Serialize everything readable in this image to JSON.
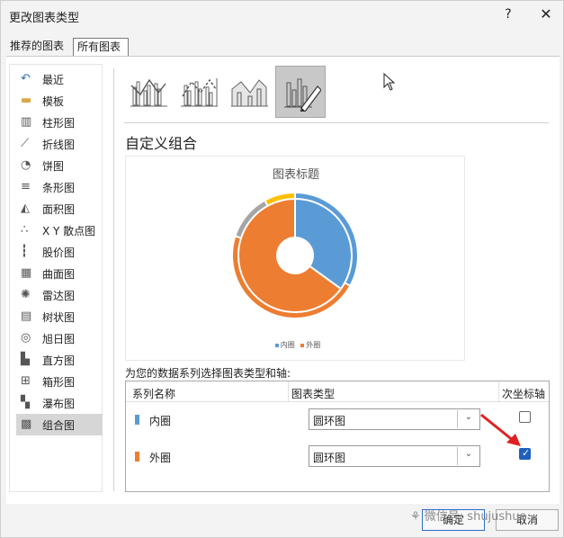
{
  "window": {
    "title": "更改图表类型",
    "help": "?",
    "close": "✕"
  },
  "tabs": [
    {
      "label": "推荐的图表",
      "active": false
    },
    {
      "label": "所有图表",
      "active": true
    }
  ],
  "sidebar": {
    "items": [
      {
        "label": "最近",
        "icon": "recent-icon"
      },
      {
        "label": "模板",
        "icon": "folder-icon"
      },
      {
        "label": "柱形图",
        "icon": "column-chart-icon"
      },
      {
        "label": "折线图",
        "icon": "line-chart-icon"
      },
      {
        "label": "饼图",
        "icon": "pie-chart-icon"
      },
      {
        "label": "条形图",
        "icon": "bar-chart-icon"
      },
      {
        "label": "面积图",
        "icon": "area-chart-icon"
      },
      {
        "label": "X Y 散点图",
        "icon": "scatter-chart-icon"
      },
      {
        "label": "股价图",
        "icon": "stock-chart-icon"
      },
      {
        "label": "曲面图",
        "icon": "surface-chart-icon"
      },
      {
        "label": "雷达图",
        "icon": "radar-chart-icon"
      },
      {
        "label": "树状图",
        "icon": "treemap-chart-icon"
      },
      {
        "label": "旭日图",
        "icon": "sunburst-chart-icon"
      },
      {
        "label": "直方图",
        "icon": "histogram-chart-icon"
      },
      {
        "label": "箱形图",
        "icon": "box-whisker-chart-icon"
      },
      {
        "label": "瀑布图",
        "icon": "waterfall-chart-icon"
      },
      {
        "label": "组合图",
        "icon": "combo-chart-icon",
        "selected": true
      }
    ]
  },
  "subtypes": [
    {
      "icon": "clustered-column-line-icon",
      "selected": false
    },
    {
      "icon": "clustered-column-line-secondary-icon",
      "selected": false
    },
    {
      "icon": "stacked-area-column-icon",
      "selected": false
    },
    {
      "icon": "custom-combination-icon",
      "selected": true
    }
  ],
  "section_title": "自定义组合",
  "preview": {
    "chart_title": "图表标题",
    "legend": [
      "内圈",
      "外圈"
    ]
  },
  "chart_data": {
    "type": "pie",
    "subtype": "doughnut",
    "title": "图表标题",
    "series": [
      {
        "name": "内圈",
        "values": [
          35,
          65
        ],
        "colors": [
          "#5b9bd5",
          "#ed7d31"
        ]
      },
      {
        "name": "外圈",
        "values": [
          33,
          47,
          12,
          8
        ],
        "colors": [
          "#5b9bd5",
          "#ed7d31",
          "#a5a5a5",
          "#ffc000"
        ]
      }
    ],
    "legend": "bottom"
  },
  "series_config": {
    "prompt": "为您的数据系列选择图表类型和轴:",
    "headers": {
      "name": "系列名称",
      "type": "图表类型",
      "secondary": "次坐标轴"
    },
    "rows": [
      {
        "name": "内圈",
        "color": "#5b9bd5",
        "type": "圆环图",
        "secondary": false
      },
      {
        "name": "外圈",
        "color": "#ed7d31",
        "type": "圆环图",
        "secondary": true
      }
    ]
  },
  "buttons": {
    "ok": "确定",
    "cancel": "取消"
  },
  "watermark": "微信号: shujushuo"
}
